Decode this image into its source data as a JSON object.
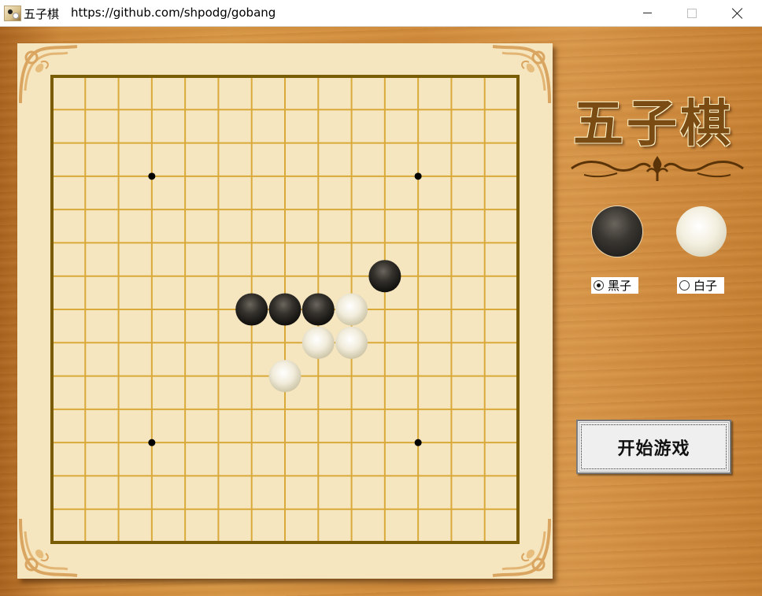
{
  "window": {
    "title": "五子棋",
    "url": "https://github.com/shpodg/gobang"
  },
  "board": {
    "size": 15,
    "star_points": [
      [
        3,
        3
      ],
      [
        11,
        3
      ],
      [
        3,
        11
      ],
      [
        11,
        11
      ]
    ],
    "stones": [
      {
        "col": 10,
        "row": 6,
        "color": "black"
      },
      {
        "col": 6,
        "row": 7,
        "color": "black"
      },
      {
        "col": 7,
        "row": 7,
        "color": "black"
      },
      {
        "col": 8,
        "row": 7,
        "color": "black"
      },
      {
        "col": 9,
        "row": 7,
        "color": "white"
      },
      {
        "col": 8,
        "row": 8,
        "color": "white"
      },
      {
        "col": 9,
        "row": 8,
        "color": "white"
      },
      {
        "col": 7,
        "row": 9,
        "color": "white"
      }
    ],
    "colors": {
      "background": "#f6e6bf",
      "grid_line": "#d9a93a",
      "border": "#7a5c05",
      "star": "#000000"
    }
  },
  "sidebar": {
    "logo_text": "五子棋",
    "black_option": {
      "label": "黑子",
      "checked": true
    },
    "white_option": {
      "label": "白子",
      "checked": false
    },
    "start_button": "开始游戏"
  }
}
